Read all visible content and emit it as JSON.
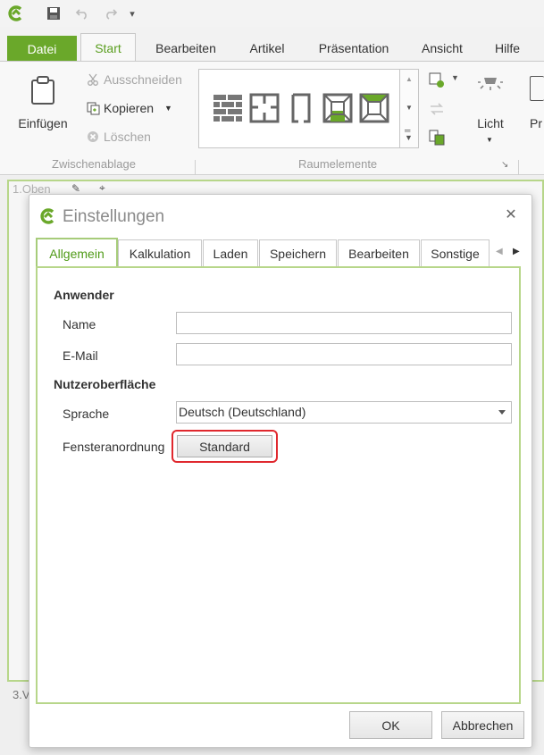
{
  "qat": {
    "more": "▾"
  },
  "tabs": [
    "Datei",
    "Start",
    "Bearbeiten",
    "Artikel",
    "Präsentation",
    "Ansicht",
    "Hilfe"
  ],
  "ribbon": {
    "paste_label": "Einfügen",
    "cut_label": "Ausschneiden",
    "copy_label": "Kopieren",
    "delete_label": "Löschen",
    "group_clipboard": "Zwischenablage",
    "group_room": "Raumelemente",
    "light_label": "Licht",
    "pr_label": "Pr"
  },
  "workspace": {
    "view_top": "1.Oben",
    "view_bottom": "3.V"
  },
  "dialog": {
    "title": "Einstellungen",
    "tabs": [
      "Allgemein",
      "Kalkulation",
      "Laden",
      "Speichern",
      "Bearbeiten",
      "Sonstige"
    ],
    "section_user": "Anwender",
    "name_label": "Name",
    "name_value": "",
    "email_label": "E-Mail",
    "email_value": "",
    "section_ui": "Nutzeroberfläche",
    "language_label": "Sprache",
    "language_value": "Deutsch (Deutschland)",
    "window_label": "Fensteranordnung",
    "standard_button": "Standard",
    "ok_button": "OK",
    "cancel_button": "Abbrechen"
  },
  "colors": {
    "accent": "#6aa82a",
    "highlight": "#e0282e"
  }
}
